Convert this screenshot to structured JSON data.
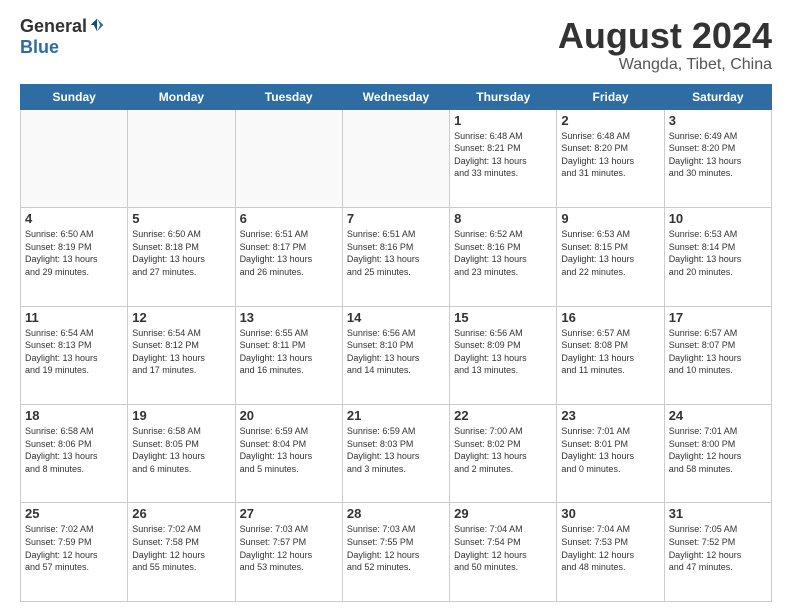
{
  "header": {
    "logo_general": "General",
    "logo_blue": "Blue",
    "title": "August 2024",
    "location": "Wangda, Tibet, China"
  },
  "days_of_week": [
    "Sunday",
    "Monday",
    "Tuesday",
    "Wednesday",
    "Thursday",
    "Friday",
    "Saturday"
  ],
  "weeks": [
    [
      {
        "day": "",
        "info": ""
      },
      {
        "day": "",
        "info": ""
      },
      {
        "day": "",
        "info": ""
      },
      {
        "day": "",
        "info": ""
      },
      {
        "day": "1",
        "info": "Sunrise: 6:48 AM\nSunset: 8:21 PM\nDaylight: 13 hours\nand 33 minutes."
      },
      {
        "day": "2",
        "info": "Sunrise: 6:48 AM\nSunset: 8:20 PM\nDaylight: 13 hours\nand 31 minutes."
      },
      {
        "day": "3",
        "info": "Sunrise: 6:49 AM\nSunset: 8:20 PM\nDaylight: 13 hours\nand 30 minutes."
      }
    ],
    [
      {
        "day": "4",
        "info": "Sunrise: 6:50 AM\nSunset: 8:19 PM\nDaylight: 13 hours\nand 29 minutes."
      },
      {
        "day": "5",
        "info": "Sunrise: 6:50 AM\nSunset: 8:18 PM\nDaylight: 13 hours\nand 27 minutes."
      },
      {
        "day": "6",
        "info": "Sunrise: 6:51 AM\nSunset: 8:17 PM\nDaylight: 13 hours\nand 26 minutes."
      },
      {
        "day": "7",
        "info": "Sunrise: 6:51 AM\nSunset: 8:16 PM\nDaylight: 13 hours\nand 25 minutes."
      },
      {
        "day": "8",
        "info": "Sunrise: 6:52 AM\nSunset: 8:16 PM\nDaylight: 13 hours\nand 23 minutes."
      },
      {
        "day": "9",
        "info": "Sunrise: 6:53 AM\nSunset: 8:15 PM\nDaylight: 13 hours\nand 22 minutes."
      },
      {
        "day": "10",
        "info": "Sunrise: 6:53 AM\nSunset: 8:14 PM\nDaylight: 13 hours\nand 20 minutes."
      }
    ],
    [
      {
        "day": "11",
        "info": "Sunrise: 6:54 AM\nSunset: 8:13 PM\nDaylight: 13 hours\nand 19 minutes."
      },
      {
        "day": "12",
        "info": "Sunrise: 6:54 AM\nSunset: 8:12 PM\nDaylight: 13 hours\nand 17 minutes."
      },
      {
        "day": "13",
        "info": "Sunrise: 6:55 AM\nSunset: 8:11 PM\nDaylight: 13 hours\nand 16 minutes."
      },
      {
        "day": "14",
        "info": "Sunrise: 6:56 AM\nSunset: 8:10 PM\nDaylight: 13 hours\nand 14 minutes."
      },
      {
        "day": "15",
        "info": "Sunrise: 6:56 AM\nSunset: 8:09 PM\nDaylight: 13 hours\nand 13 minutes."
      },
      {
        "day": "16",
        "info": "Sunrise: 6:57 AM\nSunset: 8:08 PM\nDaylight: 13 hours\nand 11 minutes."
      },
      {
        "day": "17",
        "info": "Sunrise: 6:57 AM\nSunset: 8:07 PM\nDaylight: 13 hours\nand 10 minutes."
      }
    ],
    [
      {
        "day": "18",
        "info": "Sunrise: 6:58 AM\nSunset: 8:06 PM\nDaylight: 13 hours\nand 8 minutes."
      },
      {
        "day": "19",
        "info": "Sunrise: 6:58 AM\nSunset: 8:05 PM\nDaylight: 13 hours\nand 6 minutes."
      },
      {
        "day": "20",
        "info": "Sunrise: 6:59 AM\nSunset: 8:04 PM\nDaylight: 13 hours\nand 5 minutes."
      },
      {
        "day": "21",
        "info": "Sunrise: 6:59 AM\nSunset: 8:03 PM\nDaylight: 13 hours\nand 3 minutes."
      },
      {
        "day": "22",
        "info": "Sunrise: 7:00 AM\nSunset: 8:02 PM\nDaylight: 13 hours\nand 2 minutes."
      },
      {
        "day": "23",
        "info": "Sunrise: 7:01 AM\nSunset: 8:01 PM\nDaylight: 13 hours\nand 0 minutes."
      },
      {
        "day": "24",
        "info": "Sunrise: 7:01 AM\nSunset: 8:00 PM\nDaylight: 12 hours\nand 58 minutes."
      }
    ],
    [
      {
        "day": "25",
        "info": "Sunrise: 7:02 AM\nSunset: 7:59 PM\nDaylight: 12 hours\nand 57 minutes."
      },
      {
        "day": "26",
        "info": "Sunrise: 7:02 AM\nSunset: 7:58 PM\nDaylight: 12 hours\nand 55 minutes."
      },
      {
        "day": "27",
        "info": "Sunrise: 7:03 AM\nSunset: 7:57 PM\nDaylight: 12 hours\nand 53 minutes."
      },
      {
        "day": "28",
        "info": "Sunrise: 7:03 AM\nSunset: 7:55 PM\nDaylight: 12 hours\nand 52 minutes."
      },
      {
        "day": "29",
        "info": "Sunrise: 7:04 AM\nSunset: 7:54 PM\nDaylight: 12 hours\nand 50 minutes."
      },
      {
        "day": "30",
        "info": "Sunrise: 7:04 AM\nSunset: 7:53 PM\nDaylight: 12 hours\nand 48 minutes."
      },
      {
        "day": "31",
        "info": "Sunrise: 7:05 AM\nSunset: 7:52 PM\nDaylight: 12 hours\nand 47 minutes."
      }
    ]
  ]
}
